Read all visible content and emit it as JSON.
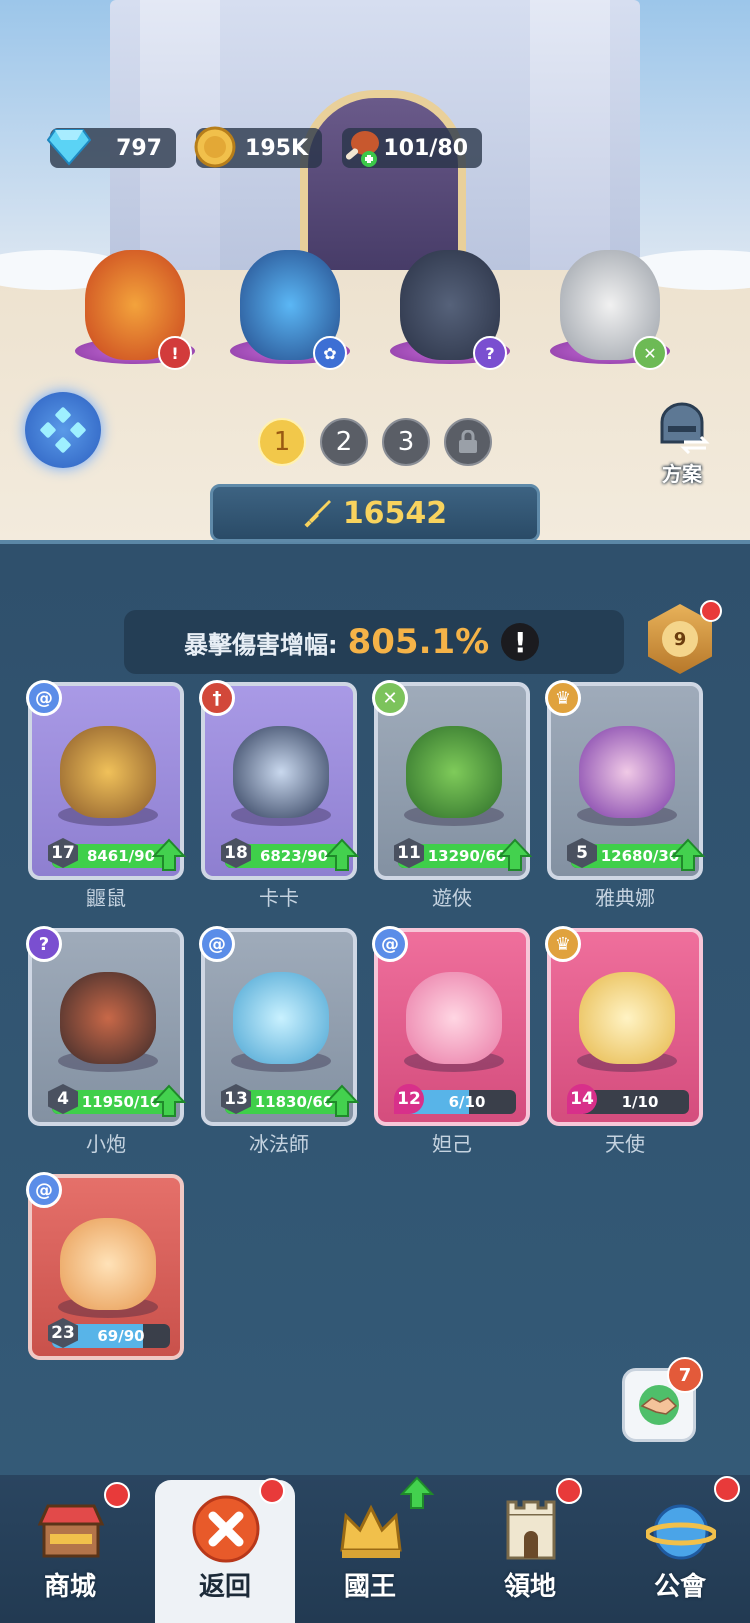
{
  "resources": {
    "gems": "797",
    "coins": "195K",
    "stamina": "101/80"
  },
  "team_slots": [
    "1",
    "2",
    "3"
  ],
  "scheme_label": "方案",
  "power": "16542",
  "crit": {
    "label": "暴擊傷害增幅:",
    "value": "805.1%",
    "info": "!"
  },
  "rank_level": "9",
  "heroes": [
    {
      "name": "鼴鼠",
      "level": "17",
      "progress": "8461/90",
      "element": "@"
    },
    {
      "name": "卡卡",
      "level": "18",
      "progress": "6823/90",
      "element": "†"
    },
    {
      "name": "遊俠",
      "level": "11",
      "progress": "13290/60",
      "element": "✕"
    },
    {
      "name": "雅典娜",
      "level": "5",
      "progress": "12680/30",
      "element": "♛"
    },
    {
      "name": "小炮",
      "level": "4",
      "progress": "11950/10",
      "element": "?"
    },
    {
      "name": "冰法師",
      "level": "13",
      "progress": "11830/60",
      "element": "@"
    },
    {
      "name": "妲己",
      "level": "12",
      "progress": "6/10",
      "element": "@"
    },
    {
      "name": "天使",
      "level": "14",
      "progress": "1/10",
      "element": "♛"
    },
    {
      "name": "",
      "level": "23",
      "progress": "69/90",
      "element": "@"
    }
  ],
  "nav": {
    "shop": "商城",
    "back": "返回",
    "king": "國王",
    "territory": "領地",
    "guild": "公會",
    "handshake_badge": "7"
  },
  "colors": {
    "gold": "#f8d35e",
    "crit_value": "#f5b348",
    "panel": "#2f506c",
    "progress_green": "#3fcf4a",
    "progress_blue": "#58b4e8"
  }
}
